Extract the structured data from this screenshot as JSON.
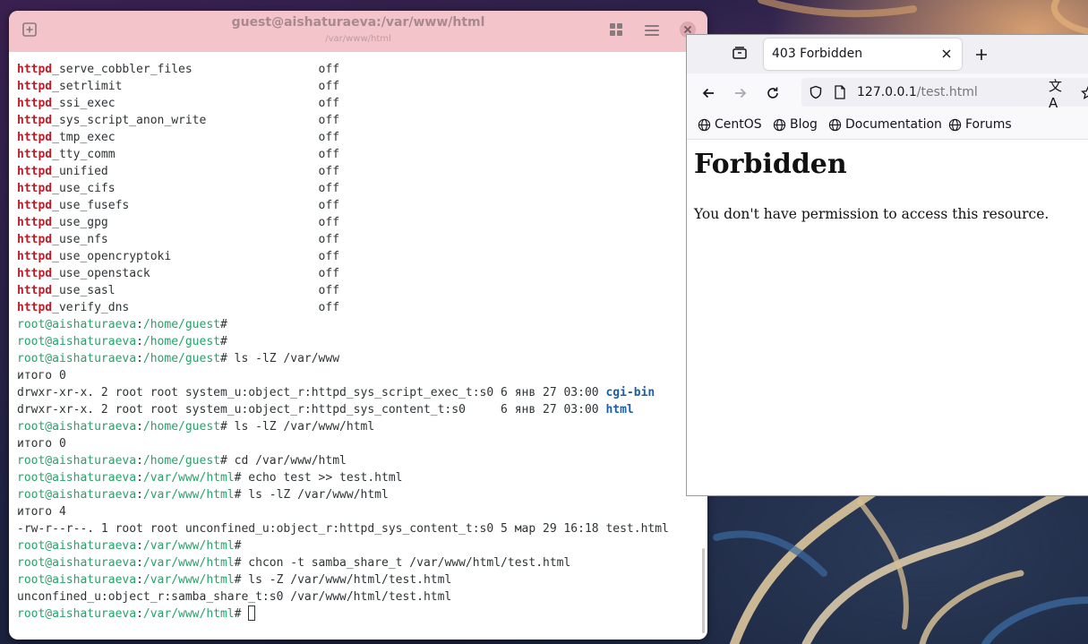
{
  "terminal": {
    "title": "guest@aishaturaeva:/var/www/html",
    "subtitle": "/var/www/html",
    "lines": [
      {
        "kw": "httpd",
        "rest": "_serve_cobbler_files                  off"
      },
      {
        "kw": "httpd",
        "rest": "_setrlimit                            off"
      },
      {
        "kw": "httpd",
        "rest": "_ssi_exec                             off"
      },
      {
        "kw": "httpd",
        "rest": "_sys_script_anon_write                off"
      },
      {
        "kw": "httpd",
        "rest": "_tmp_exec                             off"
      },
      {
        "kw": "httpd",
        "rest": "_tty_comm                             off"
      },
      {
        "kw": "httpd",
        "rest": "_unified                              off"
      },
      {
        "kw": "httpd",
        "rest": "_use_cifs                             off"
      },
      {
        "kw": "httpd",
        "rest": "_use_fusefs                           off"
      },
      {
        "kw": "httpd",
        "rest": "_use_gpg                              off"
      },
      {
        "kw": "httpd",
        "rest": "_use_nfs                              off"
      },
      {
        "kw": "httpd",
        "rest": "_use_opencryptoki                     off"
      },
      {
        "kw": "httpd",
        "rest": "_use_openstack                        off"
      },
      {
        "kw": "httpd",
        "rest": "_use_sasl                             off"
      },
      {
        "kw": "httpd",
        "rest": "_verify_dns                           off"
      },
      {
        "user": "root@aishaturaeva",
        "path": "/home/guest",
        "cmd": ""
      },
      {
        "user": "root@aishaturaeva",
        "path": "/home/guest",
        "cmd": ""
      },
      {
        "user": "root@aishaturaeva",
        "path": "/home/guest",
        "cmd": " ls -lZ /var/www"
      },
      {
        "text": "итого 0"
      },
      {
        "text": "drwxr-xr-x. 2 root root system_u:object_r:httpd_sys_script_exec_t:s0 6 янв 27 03:00 ",
        "dir": "cgi-bin"
      },
      {
        "text": "drwxr-xr-x. 2 root root system_u:object_r:httpd_sys_content_t:s0     6 янв 27 03:00 ",
        "dir": "html"
      },
      {
        "user": "root@aishaturaeva",
        "path": "/home/guest",
        "cmd": " ls -lZ /var/www/html"
      },
      {
        "text": "итого 0"
      },
      {
        "user": "root@aishaturaeva",
        "path": "/home/guest",
        "cmd": " cd /var/www/html"
      },
      {
        "user": "root@aishaturaeva",
        "path": "/var/www/html",
        "cmd": " echo test >> test.html"
      },
      {
        "user": "root@aishaturaeva",
        "path": "/var/www/html",
        "cmd": " ls -lZ /var/www/html"
      },
      {
        "text": "итого 4"
      },
      {
        "text": "-rw-r--r--. 1 root root unconfined_u:object_r:httpd_sys_content_t:s0 5 мар 29 16:18 test.html"
      },
      {
        "user": "root@aishaturaeva",
        "path": "/var/www/html",
        "cmd": ""
      },
      {
        "user": "root@aishaturaeva",
        "path": "/var/www/html",
        "cmd": " chcon -t samba_share_t /var/www/html/test.html"
      },
      {
        "user": "root@aishaturaeva",
        "path": "/var/www/html",
        "cmd": " ls -Z /var/www/html/test.html"
      },
      {
        "text": "unconfined_u:object_r:samba_share_t:s0 /var/www/html/test.html"
      },
      {
        "user": "root@aishaturaeva",
        "path": "/var/www/html",
        "cmd": " ",
        "cursor": true
      }
    ]
  },
  "browser": {
    "tab_title": "403 Forbidden",
    "url_host": "127.0.0.1",
    "url_path": "/test.html",
    "bookmarks": [
      "CentOS",
      "Blog",
      "Documentation",
      "Forums"
    ],
    "page_heading": "Forbidden",
    "page_text": "You don't have permission to access this resource."
  }
}
